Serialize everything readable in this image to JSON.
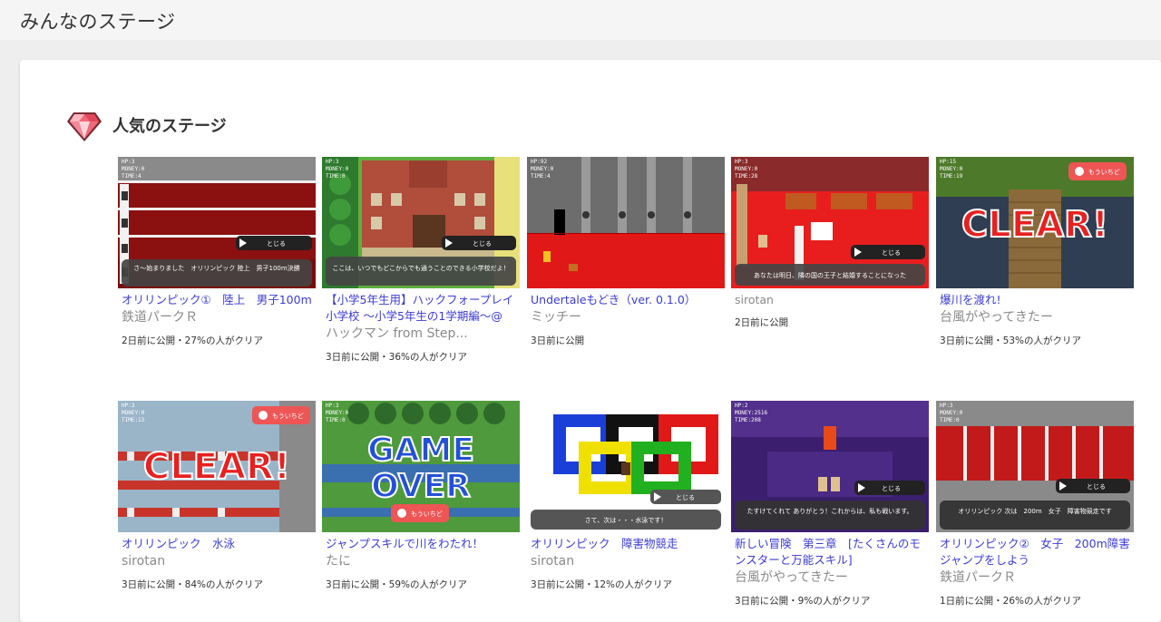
{
  "header": {
    "title": "みんなのステージ"
  },
  "section": {
    "title": "人気のステージ",
    "icon": "gem-icon"
  },
  "common": {
    "close_btn": "とじる",
    "retry_btn": "もういちど",
    "clear": "CLEAR!",
    "game": "GAME",
    "over": "OVER"
  },
  "cards": [
    {
      "title": "オリリンピック①　陸上　男子100m",
      "author": "鉄道パークＲ",
      "meta": "2日前に公開・27%の人がクリア",
      "hud": [
        "HP:3",
        "MONEY:0",
        "TIME:4"
      ],
      "dialog": "さ〜始まりました　オリリンピック 陸上　男子100m決勝"
    },
    {
      "title": "【小学5年生用】ハックフォープレイ小学校 〜小学5年生の1学期編〜@",
      "author": "ハックマン from Step...",
      "meta": "3日前に公開・36%の人がクリア",
      "hud": [
        "HP:3",
        "MONEY:0",
        "TIME:0"
      ],
      "dialog": "ここは、いつでもどこからでも通うことのできる小学校だよ！"
    },
    {
      "title": "Undertaleもどき（ver. 0.1.0）",
      "author": "ミッチー",
      "meta": "3日前に公開",
      "hud": [
        "HP:92",
        "MONEY:0",
        "TIME:4"
      ]
    },
    {
      "title": "sirotan",
      "author": "",
      "meta": "2日前に公開",
      "hud": [
        "HP:3",
        "MONEY:0",
        "TIME:28"
      ],
      "dialog": "あなたは明日、隣の国の王子と結婚することになった"
    },
    {
      "title": "爆川を渡れ!",
      "author": "台風がやってきたー",
      "meta": "3日前に公開・53%の人がクリア",
      "hud": [
        "HP:15",
        "MONEY:0",
        "TIME:19"
      ]
    },
    {
      "title": "オリリンピック　水泳",
      "author": "sirotan",
      "meta": "3日前に公開・84%の人がクリア",
      "hud": [
        "HP:3",
        "MONEY:0",
        "TIME:13"
      ]
    },
    {
      "title": "ジャンプスキルで川をわたれ！",
      "author": "たに",
      "meta": "3日前に公開・59%の人がクリア",
      "hud": [
        "HP:3",
        "MONEY:0",
        "TIME:0"
      ]
    },
    {
      "title": "オリリンピック　障害物競走",
      "author": "sirotan",
      "meta": "3日前に公開・12%の人がクリア",
      "hud": [
        "HP:3",
        "MONEY:0",
        "TIME:3"
      ],
      "dialog": "さて、次は・・・水泳です！"
    },
    {
      "title": "新しい冒険　第三章　[たくさんのモンスターと万能スキル]",
      "author": "台風がやってきたー",
      "meta": "3日前に公開・9%の人がクリア",
      "hud": [
        "HP:2",
        "MONEY:2516",
        "TIME:208"
      ],
      "dialog": "たすけてくれて ありがとう！これからは、私も戦います。"
    },
    {
      "title": "オリリンピック②　女子　200m障害　ジャンプをしよう",
      "author": "鉄道パークＲ",
      "meta": "1日前に公開・26%の人がクリア",
      "hud": [
        "HP:3",
        "MONEY:0",
        "TIME:0"
      ],
      "dialog": "オリリンピック 次は　200m　女子　障害物競走です"
    }
  ]
}
